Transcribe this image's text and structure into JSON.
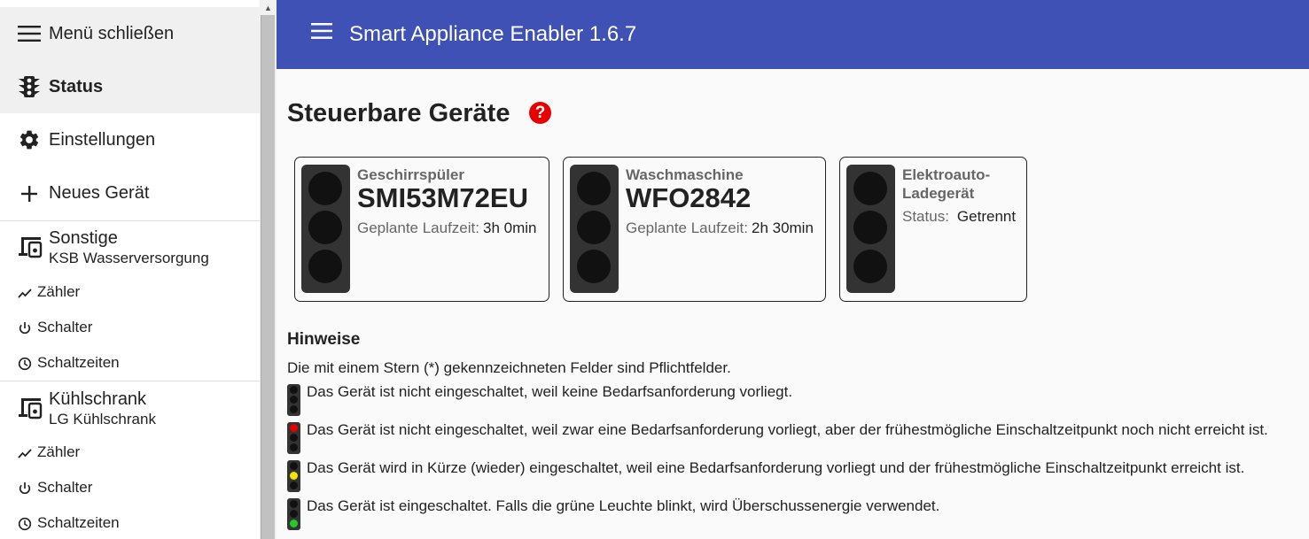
{
  "sidebar": {
    "close_menu": "Menü schließen",
    "status": "Status",
    "settings": "Einstellungen",
    "new_device": "Neues Gerät",
    "groups": [
      {
        "title": "Sonstige",
        "subtitle": "KSB Wasserversorgung",
        "items": [
          "Zähler",
          "Schalter",
          "Schaltzeiten"
        ]
      },
      {
        "title": "Kühlschrank",
        "subtitle": "LG Kühlschrank",
        "items": [
          "Zähler",
          "Schalter",
          "Schaltzeiten"
        ]
      }
    ]
  },
  "header": {
    "title": "Smart Appliance Enabler 1.6.7"
  },
  "main": {
    "title": "Steuerbare Geräte",
    "help_symbol": "?",
    "devices": [
      {
        "type": "Geschirrspüler",
        "name": "SMI53M72EU",
        "info_label": "Geplante Laufzeit:",
        "info_value": "3h 0min"
      },
      {
        "type": "Waschmaschine",
        "name": "WFO2842",
        "info_label": "Geplante Laufzeit:",
        "info_value": "2h 30min"
      },
      {
        "type_line1": "Elektroauto-",
        "type_line2": "Ladegerät",
        "info_label": "Status:",
        "info_value": "Getrennt"
      }
    ],
    "hints": {
      "title": "Hinweise",
      "intro": "Die mit einem Stern (*) gekennzeichneten Felder sind Pflichtfelder.",
      "legend": [
        {
          "text": "Das Gerät ist nicht eingeschaltet, weil keine Bedarfsanforderung vorliegt.",
          "active_lamp": "none"
        },
        {
          "text": "Das Gerät ist nicht eingeschaltet, weil zwar eine Bedarfsanforderung vorliegt, aber der frühestmögliche Einschaltzeitpunkt noch nicht erreicht ist.",
          "active_lamp": "red"
        },
        {
          "text": "Das Gerät wird in Kürze (wieder) eingeschaltet, weil eine Bedarfsanforderung vorliegt und der frühestmögliche Einschaltzeitpunkt erreicht ist.",
          "active_lamp": "yellow"
        },
        {
          "text": "Das Gerät ist eingeschaltet. Falls die grüne Leuchte blinkt, wird Überschussenergie verwendet.",
          "active_lamp": "green"
        }
      ]
    }
  },
  "colors": {
    "header_bg": "#3f51b5",
    "lamp_off": "#111111",
    "lamp_red": "#e60000",
    "lamp_yellow": "#f2e600",
    "lamp_green": "#22cc22",
    "help_red": "#e60000"
  }
}
